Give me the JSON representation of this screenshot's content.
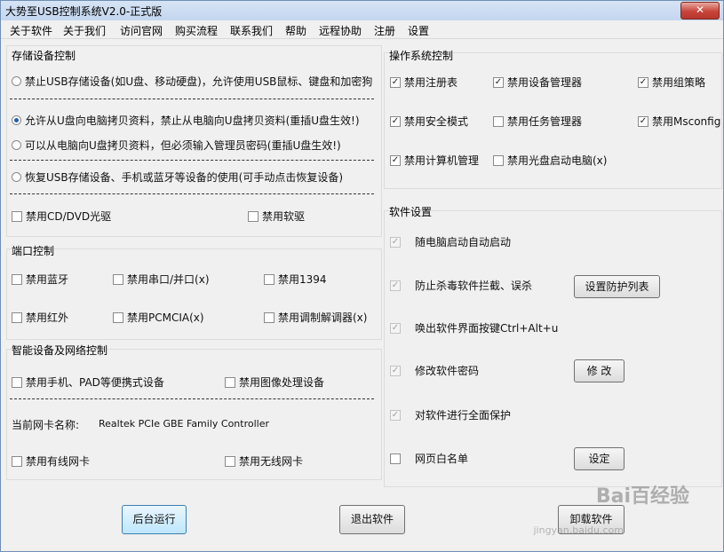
{
  "window": {
    "title": "大势至USB控制系统V2.0-正式版",
    "close_glyph": "✕"
  },
  "menu": [
    "关于软件",
    "关于我们",
    "访问官网",
    "购买流程",
    "联系我们",
    "帮助",
    "远程协助",
    "注册",
    "设置"
  ],
  "storage": {
    "title": "存储设备控制",
    "options": [
      {
        "label": "禁止USB存储设备(如U盘、移动硬盘)，允许使用USB鼠标、键盘和加密狗",
        "selected": false
      },
      {
        "label": "允许从U盘向电脑拷贝资料，禁止从电脑向U盘拷贝资料(重插U盘生效!)",
        "selected": true
      },
      {
        "label": "可以从电脑向U盘拷贝资料，但必须输入管理员密码(重插U盘生效!)",
        "selected": false
      },
      {
        "label": "恢复USB存储设备、手机或蓝牙等设备的使用(可手动点击恢复设备)",
        "selected": false
      }
    ],
    "cd": {
      "label": "禁用CD/DVD光驱",
      "checked": false
    },
    "floppy": {
      "label": "禁用软驱",
      "checked": false
    }
  },
  "port": {
    "title": "端口控制",
    "items": [
      {
        "label": "禁用蓝牙",
        "checked": false
      },
      {
        "label": "禁用串口/并口(x)",
        "checked": false
      },
      {
        "label": "禁用1394",
        "checked": false
      },
      {
        "label": "禁用红外",
        "checked": false
      },
      {
        "label": "禁用PCMCIA(x)",
        "checked": false
      },
      {
        "label": "禁用调制解调器(x)",
        "checked": false
      }
    ]
  },
  "smart": {
    "title": "智能设备及网络控制",
    "phone": {
      "label": "禁用手机、PAD等便携式设备",
      "checked": false
    },
    "image": {
      "label": "禁用图像处理设备",
      "checked": false
    },
    "nic_label": "当前网卡名称:",
    "nic_value": "Realtek PCIe GBE Family Controller",
    "wired": {
      "label": "禁用有线网卡",
      "checked": false
    },
    "wireless": {
      "label": "禁用无线网卡",
      "checked": false
    }
  },
  "os": {
    "title": "操作系统控制",
    "items": [
      {
        "label": "禁用注册表",
        "checked": true
      },
      {
        "label": "禁用设备管理器",
        "checked": true
      },
      {
        "label": "禁用组策略",
        "checked": true
      },
      {
        "label": "禁用安全模式",
        "checked": true
      },
      {
        "label": "禁用任务管理器",
        "checked": false
      },
      {
        "label": "禁用Msconfig",
        "checked": true
      },
      {
        "label": "禁用计算机管理",
        "checked": true
      },
      {
        "label": "禁用光盘启动电脑(x)",
        "checked": false
      }
    ]
  },
  "software": {
    "title": "软件设置",
    "items": [
      {
        "label": "随电脑启动自动启动",
        "checked": true,
        "disabled": true
      },
      {
        "label": "防止杀毒软件拦截、误杀",
        "checked": true,
        "disabled": true
      },
      {
        "label": "唤出软件界面按键Ctrl+Alt+u",
        "checked": true,
        "disabled": true
      },
      {
        "label": "修改软件密码",
        "checked": true,
        "disabled": true
      },
      {
        "label": "对软件进行全面保护",
        "checked": true,
        "disabled": true
      },
      {
        "label": "网页白名单",
        "checked": false,
        "disabled": false
      }
    ],
    "protect_btn": "设置防护列表",
    "modify_btn": "修 改",
    "set_btn": "设定"
  },
  "bottom": {
    "run_bg": "后台运行",
    "exit": "退出软件",
    "uninstall": "卸载软件"
  },
  "watermark": {
    "main": "Bai百经验",
    "sub": "jingyan.baidu.com"
  },
  "check_glyph": "✓"
}
